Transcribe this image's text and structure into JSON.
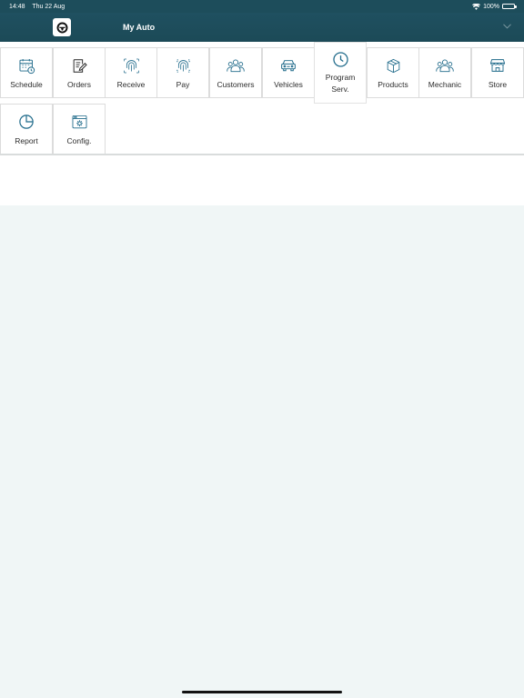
{
  "status_bar": {
    "time": "14:48",
    "date": "Thu 22 Aug",
    "battery": "100%"
  },
  "header": {
    "title": "My Auto",
    "logo_icon": "steering-wheel-icon"
  },
  "colors": {
    "header_bg": "#1d4d5b",
    "icon_accent": "#1f6a8a",
    "page_bg": "#f0f6f6"
  },
  "menu": {
    "items": [
      {
        "label": "Schedule",
        "icon": "calendar-clock-icon"
      },
      {
        "label": "Orders",
        "icon": "document-edit-icon"
      },
      {
        "label": "Receive",
        "icon": "fingerprint-icon"
      },
      {
        "label": "Pay",
        "icon": "fingerprint-pay-icon"
      },
      {
        "label": "Customers",
        "icon": "people-icon"
      },
      {
        "label": "Vehicles",
        "icon": "car-icon"
      },
      {
        "label": "Program\nServ.",
        "icon": "clock-icon",
        "active": true
      },
      {
        "label": "Products",
        "icon": "box-icon"
      },
      {
        "label": "Mechanic",
        "icon": "people-icon"
      },
      {
        "label": "Store",
        "icon": "store-icon"
      },
      {
        "label": "Report",
        "icon": "pie-chart-icon"
      },
      {
        "label": "Config.",
        "icon": "settings-icon"
      }
    ]
  }
}
